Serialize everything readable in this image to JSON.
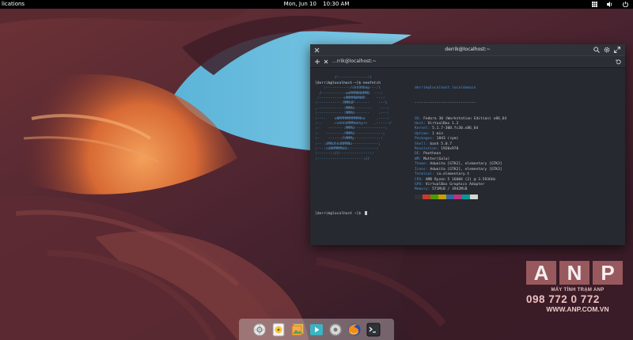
{
  "panel": {
    "applications_label": "lications",
    "date": "Mon, Jun 10",
    "time": "10:30 AM",
    "tray_icons": [
      "apps-grid-icon",
      "volume-icon",
      "power-icon"
    ]
  },
  "terminal": {
    "title": "derrik@localhost:~",
    "tab_label": "...rrik@localhost:~",
    "prompt_line": "[derrik@localhost ~]$ neofetch",
    "logo_lines": [
      "         /:-------------:\\",
      "      :-------------------::",
      "    :-----------/shhOHbmp---:\\",
      "  /-----------omMMMNNNMMD  ---:",
      " :-----------sMMMMNMNMP.    ---:",
      ":-----------:MMMdP-------    ---\\",
      ",------------:MMMd--------    ---:",
      ":------------:MMMd-------    .---:",
      ":----    oNMMMMMMMMMNho     .----:",
      ":--     .+shhhhMMMmhhy++   .------/",
      ":-    -------:MMMd--------------:",
      ":-   --------/MMMd-------------;",
      ":-    ------/hMMMy------------:",
      ":-- :dMNdhhdNMMNo------------;",
      ":---:sdNMMMMNds:------------:",
      ":------:://:-------------::",
      ":---------------------://"
    ],
    "info": {
      "header": "derrik@localhost.localdomain",
      "separator": "----------------------------",
      "rows": [
        {
          "key": "OS:",
          "value": " Fedora 30 (Workstation Edition) x86_64"
        },
        {
          "key": "Host:",
          "value": " VirtualBox 1.2"
        },
        {
          "key": "Kernel:",
          "value": " 5.1.7-300.fc30.x86_64"
        },
        {
          "key": "Uptime:",
          "value": " 1 min"
        },
        {
          "key": "Packages:",
          "value": " 1843 (rpm)"
        },
        {
          "key": "Shell:",
          "value": " bash 5.0.7"
        },
        {
          "key": "Resolution:",
          "value": " 1920x970"
        },
        {
          "key": "DE:",
          "value": " Pantheon"
        },
        {
          "key": "WM:",
          "value": " Mutter(Gala)"
        },
        {
          "key": "Theme:",
          "value": " Adwaita [GTK2], elementary [GTK3]"
        },
        {
          "key": "Icons:",
          "value": " Adwaita [GTK2], elementary [GTK3]"
        },
        {
          "key": "Terminal:",
          "value": " io.elementary.t"
        },
        {
          "key": "CPU:",
          "value": " AMD Ryzen 5 1600X (2) @ 3.593GHz"
        },
        {
          "key": "GPU:",
          "value": " VirtualBox Graphics Adapter"
        },
        {
          "key": "Memory:",
          "value": " 571MiB / 3942MiB"
        }
      ]
    },
    "palette": [
      "#2e3436",
      "#cc3a2f",
      "#4e9a06",
      "#c4a000",
      "#3465a4",
      "#c0337a",
      "#06989a",
      "#d3d7cf"
    ],
    "prompt2": "[derrik@localhost ~]$ "
  },
  "dock": {
    "items": [
      "web-browser-icon",
      "music-icon",
      "photos-icon",
      "videos-icon",
      "settings-icon",
      "firefox-icon",
      "terminal-icon"
    ]
  },
  "watermark": {
    "letters": [
      "A",
      "N",
      "P"
    ],
    "tagline": "MÁY TÍNH TRẠM ANP",
    "phone": "098 772 0 772",
    "website": "WWW.ANP.COM.VN"
  }
}
